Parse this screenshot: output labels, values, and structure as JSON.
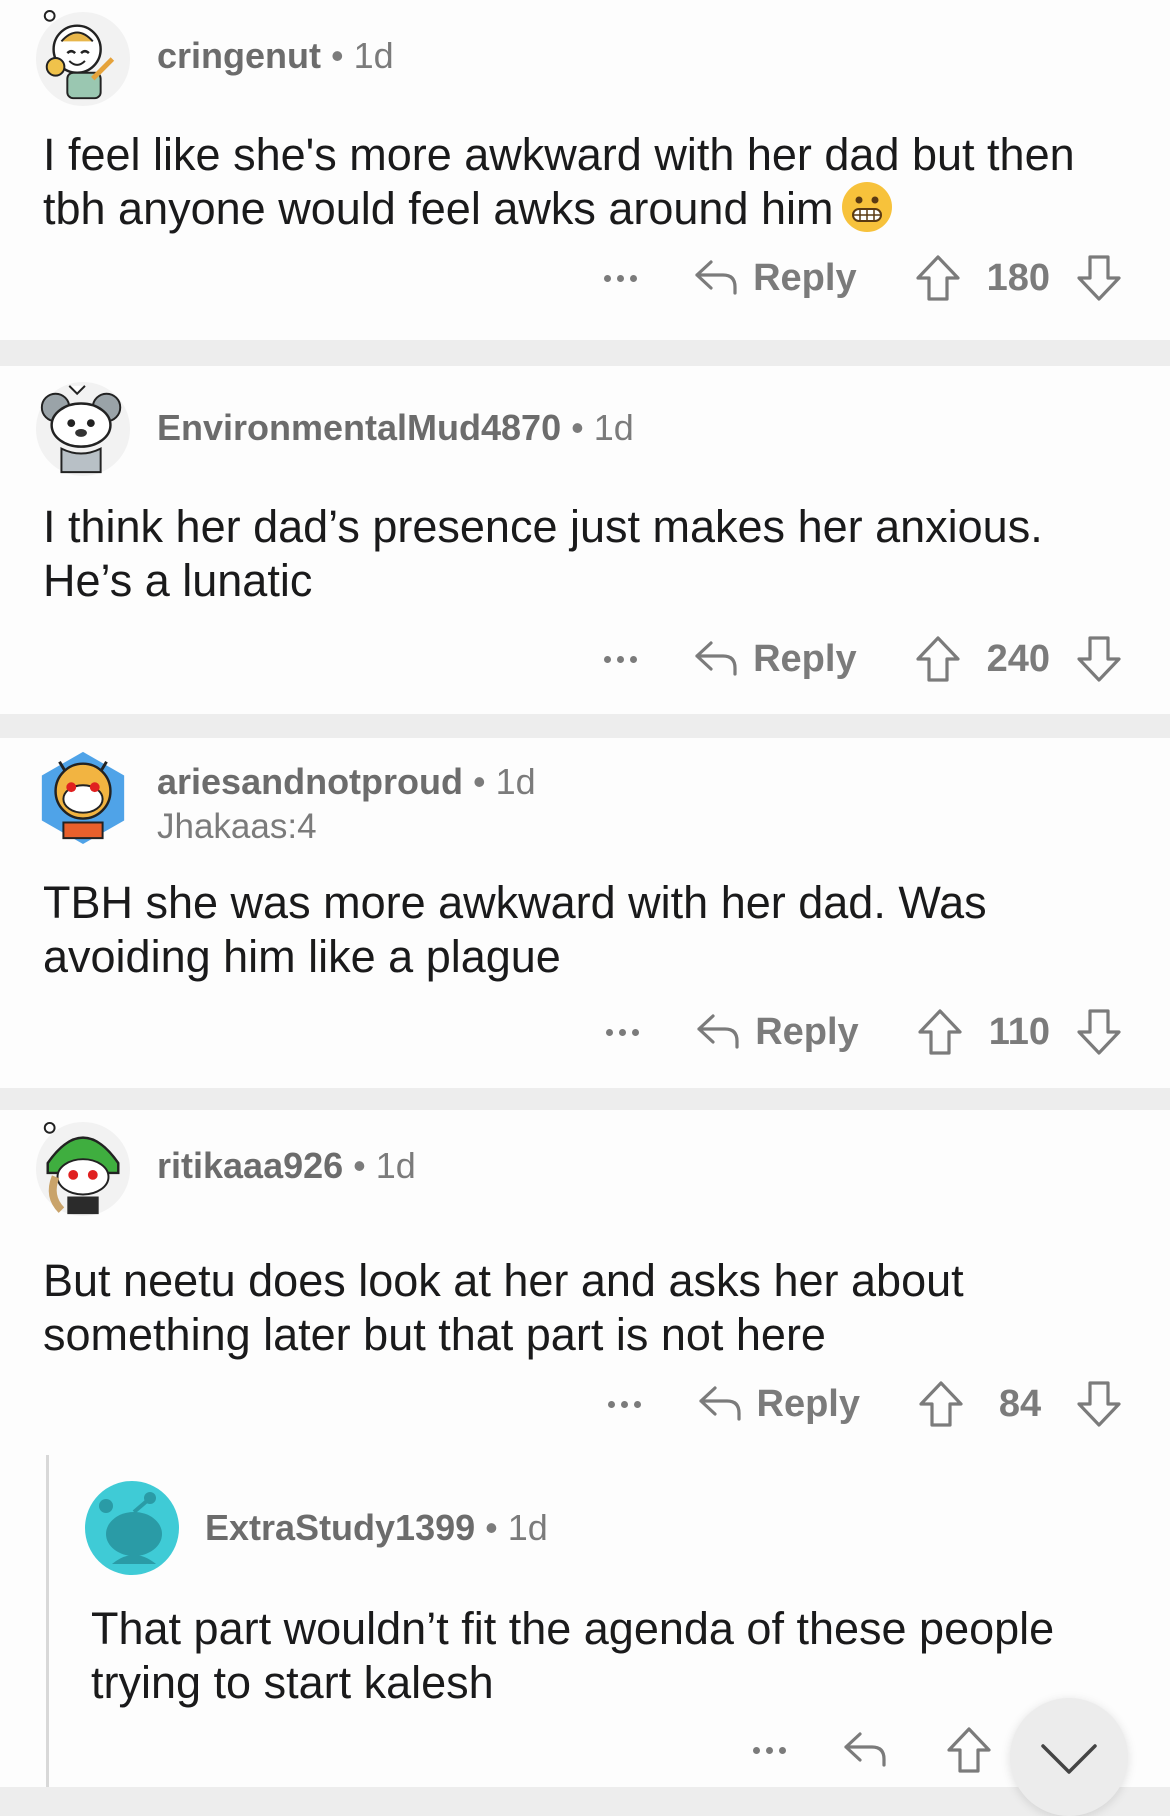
{
  "comments": [
    {
      "username": "cringenut",
      "age": "1d",
      "text": "I feel like she's more awkward with her dad but then tbh anyone would feel awks around him",
      "emoji_icon": "grimacing-face-icon",
      "reply_label": "Reply",
      "score": "180"
    },
    {
      "username": "EnvironmentalMud4870",
      "age": "1d",
      "text": "I think her dad’s presence just makes her anxious. He’s a lunatic",
      "reply_label": "Reply",
      "score": "240"
    },
    {
      "username": "ariesandnotproud",
      "age": "1d",
      "flair": "Jhakaas:4",
      "text": "TBH she was more awkward with her dad. Was avoiding him like a plague",
      "reply_label": "Reply",
      "score": "110"
    },
    {
      "username": "ritikaaa926",
      "age": "1d",
      "text": "But neetu does look at her and asks her about something later but that part is not here",
      "reply_label": "Reply",
      "score": "84"
    },
    {
      "username": "ExtraStudy1399",
      "age": "1d",
      "text": "That part wouldn’t fit the agenda of these people trying to start kalesh"
    }
  ],
  "colors": {
    "meta_text": "#7b7b7b",
    "body_text": "#1a1a1b",
    "card_bg": "#fdfdfd",
    "separator": "#ededed",
    "default_avatar": "#3fcbd6"
  }
}
